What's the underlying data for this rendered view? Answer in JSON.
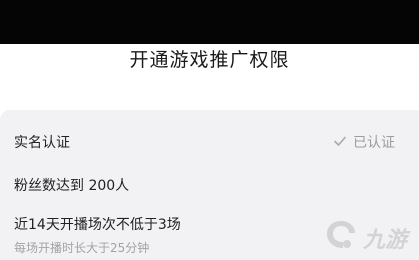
{
  "header": {
    "title": "开通游戏推广权限"
  },
  "requirements": {
    "real_name": {
      "label": "实名认证",
      "status": "已认证"
    },
    "followers": {
      "label": "粉丝数达到 200人"
    },
    "live_sessions": {
      "label": "近14天开播场次不低于3场",
      "hint": "每场开播时长大于25分钟"
    }
  },
  "watermark": {
    "text": "九游",
    "icon": "jiuyou-logo-icon"
  },
  "colors": {
    "top_bar": "#050505",
    "card_bg": "#f2f2f4",
    "muted": "#a2a2a8"
  }
}
